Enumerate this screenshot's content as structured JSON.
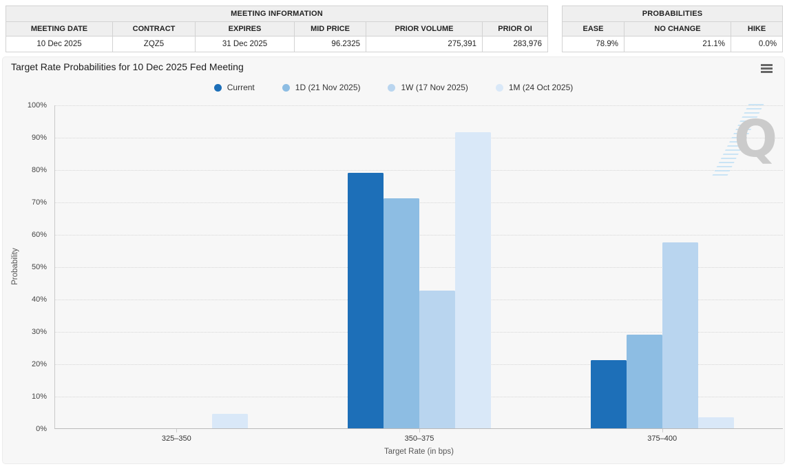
{
  "meeting_info": {
    "title": "MEETING INFORMATION",
    "headers": [
      "MEETING DATE",
      "CONTRACT",
      "EXPIRES",
      "MID PRICE",
      "PRIOR VOLUME",
      "PRIOR OI"
    ],
    "values": [
      "10 Dec 2025",
      "ZQZ5",
      "31 Dec 2025",
      "96.2325",
      "275,391",
      "283,976"
    ]
  },
  "probabilities": {
    "title": "PROBABILITIES",
    "headers": [
      "EASE",
      "NO CHANGE",
      "HIKE"
    ],
    "values": [
      "78.9%",
      "21.1%",
      "0.0%"
    ]
  },
  "chart": {
    "title": "Target Rate Probabilities for 10 Dec 2025 Fed Meeting",
    "menu_icon": "hamburger-icon",
    "watermark_letter": "Q"
  },
  "chart_data": {
    "type": "bar",
    "title": "Target Rate Probabilities for 10 Dec 2025 Fed Meeting",
    "categories": [
      "325–350",
      "350–375",
      "375–400"
    ],
    "series": [
      {
        "name": "Current",
        "color": "#1d6fb8",
        "values": [
          0,
          79,
          21
        ]
      },
      {
        "name": "1D (21 Nov 2025)",
        "color": "#8dbde3",
        "values": [
          0,
          71,
          29
        ]
      },
      {
        "name": "1W (17 Nov 2025)",
        "color": "#b9d5ef",
        "values": [
          0,
          42.5,
          57.5
        ]
      },
      {
        "name": "1M (24 Oct 2025)",
        "color": "#d9e8f8",
        "values": [
          4.5,
          91.5,
          3.5
        ]
      }
    ],
    "xlabel": "Target Rate (in bps)",
    "ylabel": "Probability",
    "ylim": [
      0,
      100
    ],
    "ytick_step": 10,
    "ytick_suffix": "%",
    "grid": "dotted-horizontal",
    "legend_position": "top-center"
  }
}
